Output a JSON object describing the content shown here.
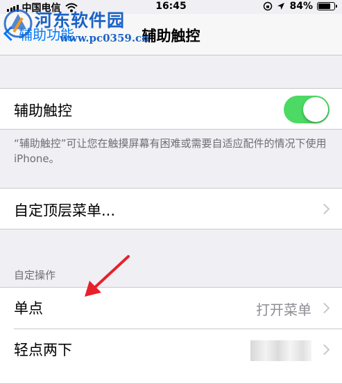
{
  "status_bar": {
    "carrier": "中国电信",
    "time": "16:45",
    "battery": "84%",
    "battery_level": 0.84
  },
  "nav": {
    "back_label": "辅助功能",
    "title": "辅助触控"
  },
  "watermark": {
    "title": "河东软件园",
    "url": "www.pc0359.cn"
  },
  "assistive_touch": {
    "label": "辅助触控",
    "enabled": true,
    "footer": "“辅助触控”可让您在触摸屏幕有困难或需要自适应配件的情况下使用 iPhone。"
  },
  "top_level_menu": {
    "label": "自定顶层菜单..."
  },
  "custom_actions": {
    "header": "自定操作",
    "rows": [
      {
        "label": "单点",
        "value": "打开菜单"
      },
      {
        "label": "轻点两下",
        "value": ""
      }
    ]
  },
  "colors": {
    "accent": "#007aff",
    "toggle_on": "#4cd964",
    "annotation_arrow": "#e8202a",
    "watermark": "#1b62c7"
  }
}
